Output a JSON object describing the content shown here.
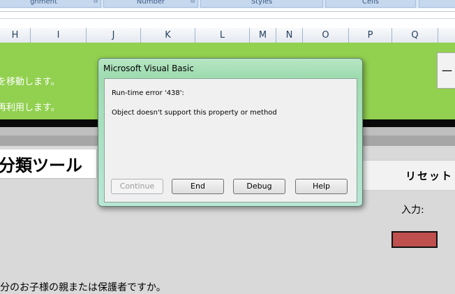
{
  "ribbon": {
    "groups": [
      "gnment",
      "Number",
      "Styles",
      "Cells",
      ""
    ]
  },
  "columns": [
    "H",
    "I",
    "J",
    "K",
    "L",
    "M",
    "N",
    "O",
    "P",
    "Q"
  ],
  "sheet": {
    "green_text_1": "を移動します。",
    "green_text_2": "再利用します。",
    "right_button_label": "一",
    "title": "分類ツール",
    "reset_label": "リセット",
    "input_label": "入力:",
    "bottom_text": "分のお子様の親または保護者ですか。",
    "accent_colors": {
      "green": "#92d050",
      "red_box": "#c0504d"
    }
  },
  "dialog": {
    "title": "Microsoft Visual Basic",
    "message_line_1": "Run-time error '438':",
    "message_line_2": "Object doesn't support this property or method",
    "buttons": {
      "continue": "Continue",
      "end": "End",
      "debug": "Debug",
      "help": "Help"
    }
  }
}
